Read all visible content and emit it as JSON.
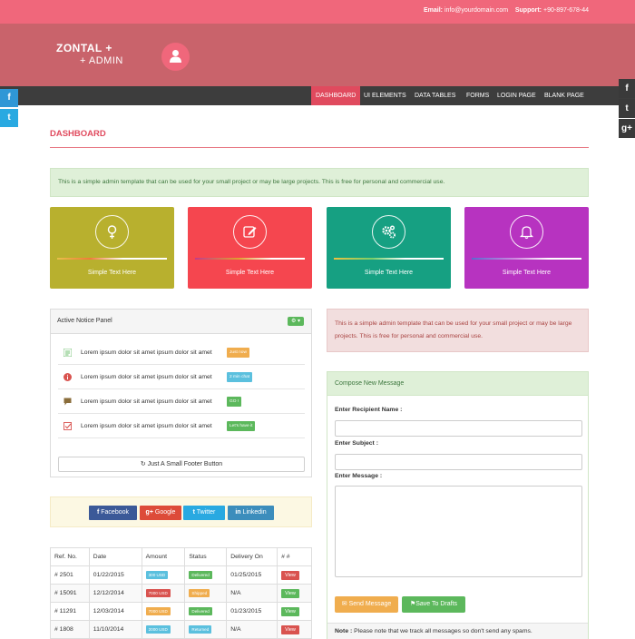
{
  "topbar": {
    "email_label": "Email:",
    "email": "info@yourdomain.com",
    "support_label": "Support:",
    "support": "+90-897-678-44"
  },
  "logo": {
    "line1": "ZONTAL +",
    "line2": "+ ADMIN"
  },
  "nav": [
    "DASHBOARD",
    "UI ELEMENTS",
    "DATA TABLES",
    "FORMS",
    "LOGIN PAGE",
    "BLANK PAGE"
  ],
  "social_left": [
    "f",
    "t"
  ],
  "social_right": [
    "f",
    "t",
    "g+"
  ],
  "page_title": "DASHBOARD",
  "alert_success": "This is a simple admin template that can be used for your small project or may be large projects. This is free for personal and commercial use.",
  "tiles": [
    {
      "icon": "female-icon",
      "text": "Simple Text Here",
      "color": "#b8b02e"
    },
    {
      "icon": "edit-icon",
      "text": "Simple Text Here",
      "color": "#f5464f"
    },
    {
      "icon": "gears-icon",
      "text": "Simple Text Here",
      "color": "#16a082"
    },
    {
      "icon": "bell-icon",
      "text": "Simple Text Here",
      "color": "#b733c0"
    }
  ],
  "notice_panel": {
    "title": "Active Notice Panel",
    "items": [
      {
        "text": "Lorem ipsum dolor sit amet ipsum dolor sit amet",
        "badge": "Just now",
        "badge_color": "#f0ad4e",
        "icon": "list-icon",
        "icon_color": "#5cb85c"
      },
      {
        "text": "Lorem ipsum dolor sit amet ipsum dolor sit amet",
        "badge": "2 min chat",
        "badge_color": "#5bc0de",
        "icon": "info-icon",
        "icon_color": "#d9534f"
      },
      {
        "text": "Lorem ipsum dolor sit amet ipsum dolor sit amet",
        "badge": "GO !",
        "badge_color": "#5cb85c",
        "icon": "comment-icon",
        "icon_color": "#8a6d3b"
      },
      {
        "text": "Lorem ipsum dolor sit amet ipsum dolor sit amet",
        "badge": "Let's have it",
        "badge_color": "#5cb85c",
        "icon": "check-square-icon",
        "icon_color": "#d9534f"
      }
    ],
    "footer_button": "Just A Small Footer Button"
  },
  "alert_danger": "This is a simple admin template that can be used for your small project or may be large projects. This is free for personal and commercial use.",
  "compose": {
    "title": "Compose New Message",
    "recipient_label": "Enter Recipient Name :",
    "subject_label": "Enter Subject :",
    "message_label": "Enter Message :",
    "send_button": "Send Message",
    "draft_button": "Save To Drafts",
    "note_label": "Note :",
    "note_text": "Please note that we track all messages so don't send any spams."
  },
  "share": [
    {
      "label": "Facebook",
      "color": "#3b5998",
      "glyph": "f"
    },
    {
      "label": "Google",
      "color": "#dd4b39",
      "glyph": "g+"
    },
    {
      "label": "Twitter",
      "color": "#29a9e1",
      "glyph": "t"
    },
    {
      "label": "Linkedin",
      "color": "#3c8dbc",
      "glyph": "in"
    }
  ],
  "table": {
    "headers": [
      "Ref. No.",
      "Date",
      "Amount",
      "Status",
      "Delivery On",
      "# #"
    ],
    "rows": [
      {
        "ref": "# 2501",
        "date": "01/22/2015",
        "amount": "300 USD",
        "amount_color": "#5bc0de",
        "status": "Delivered",
        "status_color": "#5cb85c",
        "delivery": "01/25/2015",
        "action": "View",
        "action_color": "#d9534f"
      },
      {
        "ref": "# 15091",
        "date": "12/12/2014",
        "amount": "7000 USD",
        "amount_color": "#d9534f",
        "status": "Shipped",
        "status_color": "#f0ad4e",
        "delivery": "N/A",
        "action": "View",
        "action_color": "#5cb85c"
      },
      {
        "ref": "# 11291",
        "date": "12/03/2014",
        "amount": "7000 USD",
        "amount_color": "#f0ad4e",
        "status": "Delivered",
        "status_color": "#5cb85c",
        "delivery": "01/23/2015",
        "action": "View",
        "action_color": "#5cb85c"
      },
      {
        "ref": "# 1808",
        "date": "11/10/2014",
        "amount": "2000 USD",
        "amount_color": "#5bc0de",
        "status": "Returned",
        "status_color": "#5bc0de",
        "delivery": "N/A",
        "action": "View",
        "action_color": "#d9534f"
      }
    ]
  }
}
